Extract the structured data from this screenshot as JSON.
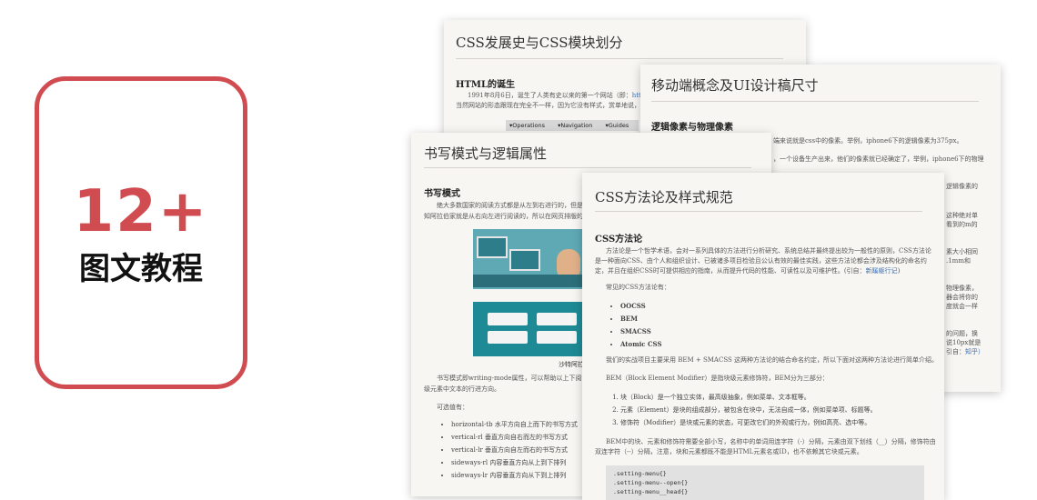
{
  "card": {
    "number": "12+",
    "label": "图文教程",
    "border_color": "#d04c50"
  },
  "doc1": {
    "title": "CSS发展史与CSS模块划分",
    "section": "HTML的诞生",
    "para1": "1991年8月6日，诞生了人类有史以来的第一个网站（即：",
    "link": "http:",
    "para2": "当然网站的形态跟现在完全不一样，因为它没有样式，赏单地说，它",
    "nav": [
      "▾Operations",
      "▾Navigation",
      "▾Guides"
    ]
  },
  "doc2": {
    "title": "移动端概念及UI设计稿尺寸",
    "section": "逻辑像素与物理像素",
    "lines": [
      "端来说就是css中的像素。举例，iphone6下的逻辑像素为375px。",
      "，一个设备生产出来，他们的像素就已经确定了，举例，iphone6下的物理",
      "逻辑像素的",
      "这种绝对单",
      "看到的m的",
      "素大小相同",
      ".1mm和",
      "物理像素，",
      "器会将你的",
      "度就会一样",
      "的问题，换",
      "说10px就是",
      "引自：",
      "知乎）"
    ]
  },
  "doc3": {
    "title": "书写模式与逻辑属性",
    "section": "书写模式",
    "para1": "绝大多数国家的阅读方式都是从左到右进行的，但是也",
    "para2": "知阿拉伯家就是从右向左进行阅读的，所以在网页排版的",
    "caption": "沙特阿拉",
    "para3": "书写模式即writing-mode属性，可以帮助以上下阅读的",
    "para4": "级元素中文本的行进方向。",
    "values_label": "可选值有：",
    "values": [
      "horizontal-tb 水平方向自上而下的书写方式",
      "vertical-rl 垂直方向自右而左的书写方式",
      "vertical-lr 垂直方向自左而右的书写方式",
      "sideways-rl 内容垂直方向从上到下排列",
      "sideways-lr 内容垂直方向从下到上排列"
    ]
  },
  "doc4": {
    "title": "CSS方法论及样式规范",
    "section": "CSS方法论",
    "para1": "方法论是一个哲学术语，会对一系列具体的方法进行分析研究、系统总结并最终提出较为一般性的原则，CSS方法论",
    "para2": "是一种面向CSS、由个人和组织设计、已被诸多项目检验且公认有效的最佳实践，这些方法论都会涉及结构化的命名约",
    "para3": "定，并且在组织CSS时可提供相应的指南，从而提升代码的性能、可读性以及可维护性。(引自：",
    "link": "新蹊躯行记",
    "para3_end": ")",
    "common_label": "常见的CSS方法论有：",
    "methods": [
      "OOCSS",
      "BEM",
      "SMACSS",
      "Atomic CSS"
    ],
    "para4": "我们的实战项目主要采用 BEM + SMACSS 这两种方法论的结合命名约定，所以下面对这两种方法论进行简单介绍。",
    "bem_intro": "BEM（Block Element Modifier）是指块级元素修饰符，BEM分为三部分：",
    "bem_parts": [
      "块（Block）是一个独立实体，最高级抽象，例如菜单、文本框等。",
      "元素（Element）是块的组成部分，被包含在块中，无法自成一体，例如菜单项、标题等。",
      "修饰符（Modifier）是块或元素的状态，可更改它们的外观或行为，例如高亮、选中等。"
    ],
    "para5": "BEM中的块、元素和修饰符需要全部小写，名称中的单词用连字符（-）分隔，元素由双下划线（__）分隔，修饰符由",
    "para6": "双连字符（--）分隔，注意，块和元素都既不能是HTML元素名或ID，也不依赖其它块或元素。",
    "code": [
      ".setting-menu{}",
      ".setting-menu--open{}",
      ".setting-menu__head{}"
    ]
  }
}
